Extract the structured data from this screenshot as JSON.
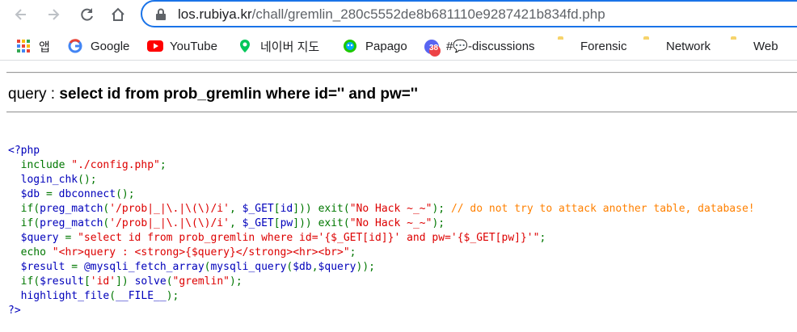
{
  "browser": {
    "url_host": "los.rubiya.kr",
    "url_path": "/chall/gremlin_280c5552de8b681110e9287421b834fd.php"
  },
  "bookmarks": [
    {
      "label": "앱",
      "icon": "apps-grid-icon"
    },
    {
      "label": "Google",
      "icon": "google-icon"
    },
    {
      "label": "YouTube",
      "icon": "youtube-icon"
    },
    {
      "label": "네이버 지도",
      "icon": "naver-map-icon"
    },
    {
      "label": "Papago",
      "icon": "papago-icon"
    },
    {
      "label": "#💬-discussions",
      "icon": "discord-icon",
      "badge": "38"
    },
    {
      "label": "Forensic",
      "icon": "folder-icon"
    },
    {
      "label": "Network",
      "icon": "folder-icon"
    },
    {
      "label": "Web",
      "icon": "folder-icon"
    }
  ],
  "page": {
    "query_label": "query : ",
    "query_text": "select id from prob_gremlin where id='' and pw=''"
  },
  "code": {
    "open_tag": "<?php",
    "close_tag": "?>",
    "lines": [
      "  include \"./config.php\";",
      "  login_chk();",
      "  $db = dbconnect();",
      "  if(preg_match('/prob|_|\\.|\\(\\)/i', $_GET[id])) exit(\"No Hack ~_~\"); // do not try to attack another table, database!",
      "  if(preg_match('/prob|_|\\.|\\(\\)/i', $_GET[pw])) exit(\"No Hack ~_~\");",
      "  $query = \"select id from prob_gremlin where id='{$_GET[id]}' and pw='{$_GET[pw]}'\";",
      "  echo \"<hr>query : <strong>{$query}</strong><hr><br>\";",
      "  $result = @mysqli_fetch_array(mysqli_query($db,$query));",
      "  if($result['id']) solve(\"gremlin\");",
      "  highlight_file(__FILE__);"
    ]
  },
  "colors": {
    "keyword": "#007700",
    "string": "#dd0000",
    "default": "#0000bb",
    "comment": "#ff8000",
    "omnibox_border": "#1a73e8"
  }
}
